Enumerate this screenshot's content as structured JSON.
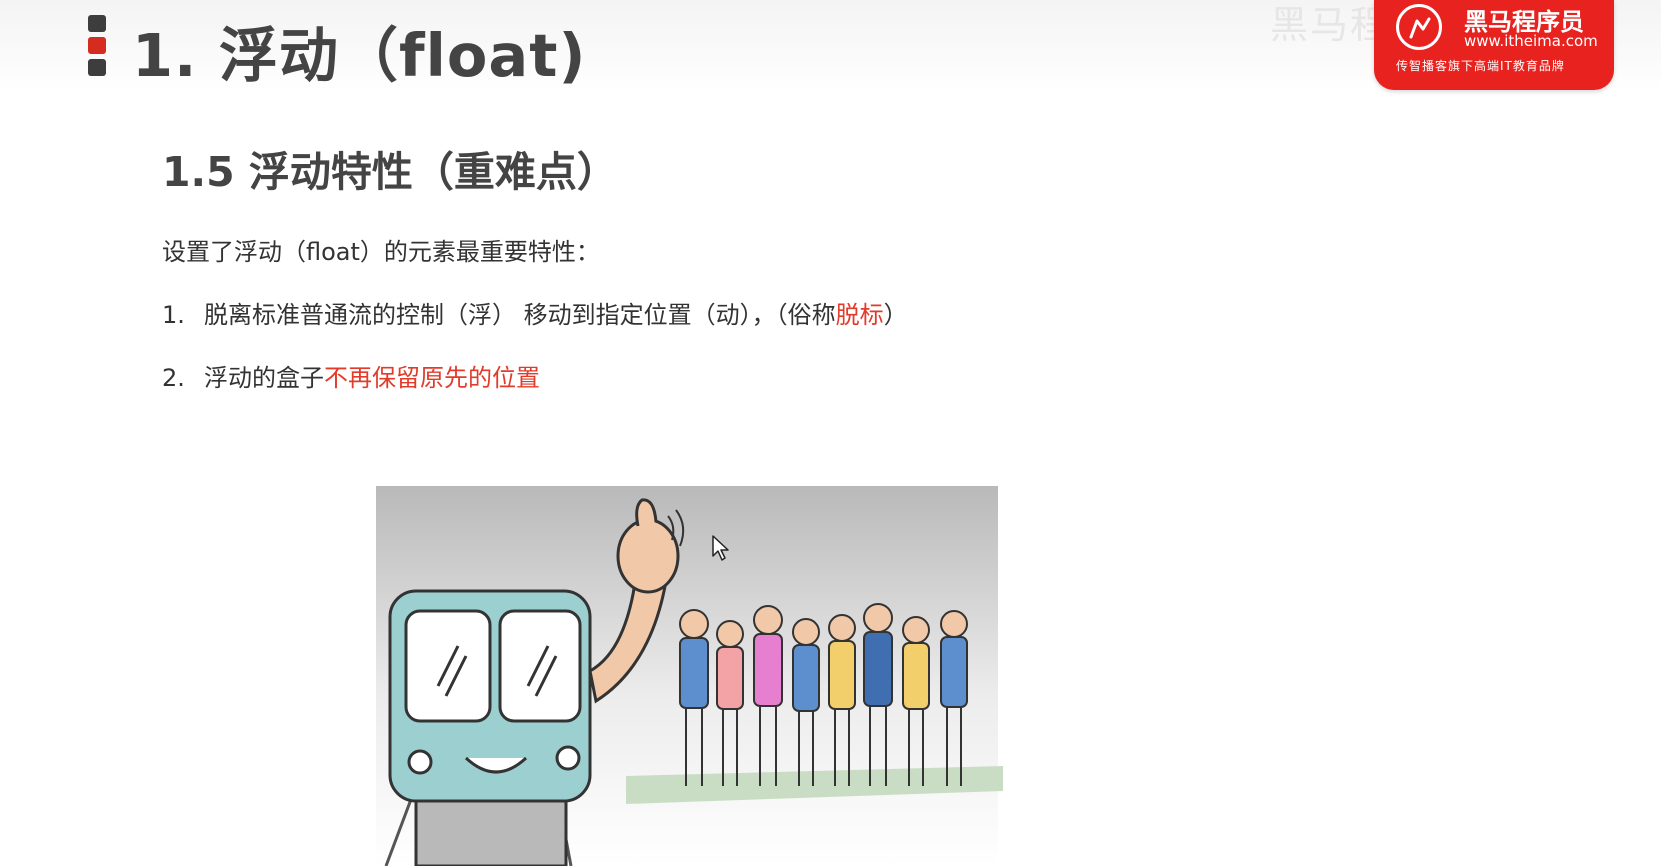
{
  "header": {
    "title": "1. 浮动（float)",
    "watermark": "黑马程序员"
  },
  "logo": {
    "brand": "黑马程序员",
    "url": "www.itheima.com",
    "tagline": "传智播客旗下高端IT教育品牌",
    "color": "#e7221f"
  },
  "section": {
    "title": "1.5 浮动特性（重难点）"
  },
  "content": {
    "intro": "设置了浮动（float）的元素最重要特性：",
    "points": [
      {
        "number": "1.",
        "text": "脱离标准普通流的控制（浮） 移动到指定位置（动），（俗称",
        "highlight": "脱标",
        "suffix": "）"
      },
      {
        "number": "2.",
        "text": "浮动的盒子",
        "highlight": "不再保留原先的位置",
        "suffix": ""
      }
    ]
  },
  "colors": {
    "accent_red": "#e23b2a",
    "heading": "#444444",
    "body_text": "#333333"
  },
  "icons": {
    "title_bullet": "vertical-bar-bullet-icon",
    "logo_mark": "horse-head-icon",
    "cursor": "mouse-pointer-icon"
  }
}
